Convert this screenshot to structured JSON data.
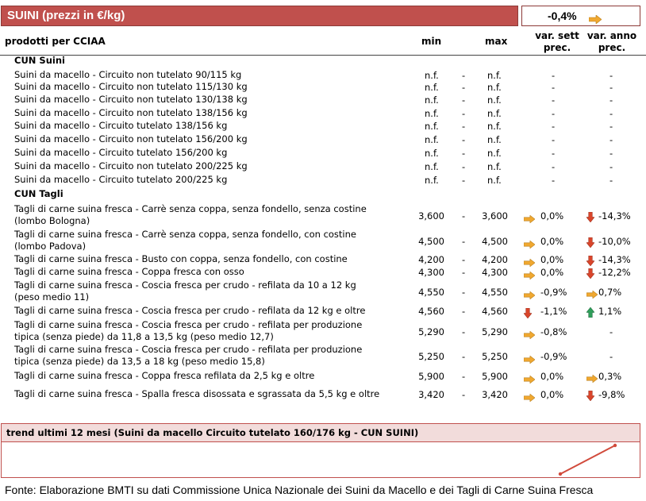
{
  "header": {
    "title": "SUINI (prezzi in €/kg)",
    "summary_value": "-0,4%",
    "summary_trend": "right"
  },
  "columns": {
    "product": "prodotti per CCIAA",
    "min": "min",
    "max": "max",
    "var_sett": "var. sett prec.",
    "var_anno": "var. anno prec."
  },
  "sections": [
    {
      "title": "CUN Suini",
      "rows": [
        {
          "name": "Suini da macello - Circuito non tutelato 90/115 kg",
          "min": "n.f.",
          "max": "n.f.",
          "sett": "-",
          "anno": "-"
        },
        {
          "name": "Suini da macello - Circuito non tutelato 115/130 kg",
          "min": "n.f.",
          "max": "n.f.",
          "sett": "-",
          "anno": "-"
        },
        {
          "name": "Suini da macello - Circuito non tutelato 130/138 kg",
          "min": "n.f.",
          "max": "n.f.",
          "sett": "-",
          "anno": "-"
        },
        {
          "name": "Suini da macello - Circuito non tutelato 138/156 kg",
          "min": "n.f.",
          "max": "n.f.",
          "sett": "-",
          "anno": "-"
        },
        {
          "name": "Suini da macello - Circuito tutelato 138/156 kg",
          "min": "n.f.",
          "max": "n.f.",
          "sett": "-",
          "anno": "-"
        },
        {
          "name": "Suini da macello - Circuito non tutelato 156/200 kg",
          "min": "n.f.",
          "max": "n.f.",
          "sett": "-",
          "anno": "-"
        },
        {
          "name": "Suini da macello - Circuito tutelato 156/200 kg",
          "min": "n.f.",
          "max": "n.f.",
          "sett": "-",
          "anno": "-"
        },
        {
          "name": "Suini da macello - Circuito non tutelato 200/225 kg",
          "min": "n.f.",
          "max": "n.f.",
          "sett": "-",
          "anno": "-"
        },
        {
          "name": "Suini da macello - Circuito tutelato 200/225 kg",
          "min": "n.f.",
          "max": "n.f.",
          "sett": "-",
          "anno": "-"
        }
      ]
    },
    {
      "title": "CUN Tagli",
      "rows": [
        {
          "name": "Tagli di carne suina fresca - Carrè senza coppa, senza fondello, senza costine",
          "name2": "(lombo Bologna)",
          "min": "3,600",
          "max": "3,600",
          "sett": "0,0%",
          "sett_icon": "right",
          "anno": "-14,3%",
          "anno_icon": "down"
        },
        {
          "name": "Tagli di carne suina fresca - Carrè senza coppa, senza fondello, con costine",
          "name2": "(lombo Padova)",
          "min": "4,500",
          "max": "4,500",
          "sett": "0,0%",
          "sett_icon": "right",
          "anno": "-10,0%",
          "anno_icon": "down"
        },
        {
          "name": "Tagli di carne suina fresca - Busto con coppa, senza fondello, con costine",
          "min": "4,200",
          "max": "4,200",
          "sett": "0,0%",
          "sett_icon": "right",
          "anno": "-14,3%",
          "anno_icon": "down"
        },
        {
          "name": "Tagli di carne suina fresca - Coppa fresca con osso",
          "min": "4,300",
          "max": "4,300",
          "sett": "0,0%",
          "sett_icon": "right",
          "anno": "-12,2%",
          "anno_icon": "down"
        },
        {
          "name": "Tagli di carne suina fresca - Coscia fresca per crudo - refilata da 10 a 12 kg",
          "name2": "(peso medio 11)",
          "min": "4,550",
          "max": "4,550",
          "sett": "-0,9%",
          "sett_icon": "right",
          "anno": "0,7%",
          "anno_icon": "right"
        },
        {
          "name": "Tagli di carne suina fresca - Coscia fresca per crudo - refilata da 12 kg e oltre",
          "min": "4,560",
          "max": "4,560",
          "sett": "-1,1%",
          "sett_icon": "down",
          "anno": "1,1%",
          "anno_icon": "up"
        },
        {
          "name": "Tagli di carne suina fresca - Coscia fresca per crudo - refilata per produzione",
          "name2": "tipica (senza piede) da 11,8 a 13,5 kg (peso medio 12,7)",
          "min": "5,290",
          "max": "5,290",
          "sett": "-0,8%",
          "sett_icon": "right",
          "anno": "-",
          "anno_icon": ""
        },
        {
          "name": "Tagli di carne suina fresca - Coscia fresca per crudo - refilata per produzione",
          "name2": "tipica (senza piede) da 13,5 a 18 kg (peso medio 15,8)",
          "min": "5,250",
          "max": "5,250",
          "sett": "-0,9%",
          "sett_icon": "right",
          "anno": "-",
          "anno_icon": ""
        },
        {
          "name": "Tagli di carne suina fresca - Coppa fresca refilata da 2,5 kg e oltre",
          "min": "5,900",
          "max": "5,900",
          "sett": "0,0%",
          "sett_icon": "right",
          "anno": "0,3%",
          "anno_icon": "right"
        },
        {
          "name": "Tagli di carne suina fresca - Spalla fresca disossata e sgrassata da 5,5 kg e oltre",
          "min": "3,420",
          "max": "3,420",
          "sett": "0,0%",
          "sett_icon": "right",
          "anno": "-9,8%",
          "anno_icon": "down"
        }
      ]
    }
  ],
  "separator": "-",
  "trend": {
    "title": "trend ultimi 12 mesi (Suini da macello Circuito tutelato 160/176 kg - CUN SUINI)"
  },
  "footer": "Fonte: Elaborazione BMTI su dati Commissione Unica Nazionale dei Suini da Macello e dei Tagli di Carne Suina Fresca",
  "colors": {
    "header_bg": "#c0504d",
    "trend_bg": "#f2dcdb",
    "arrow_right": "#f0a830",
    "arrow_down": "#d9452b",
    "arrow_up": "#2f9e5a",
    "sparkline": "#d14b3c"
  }
}
